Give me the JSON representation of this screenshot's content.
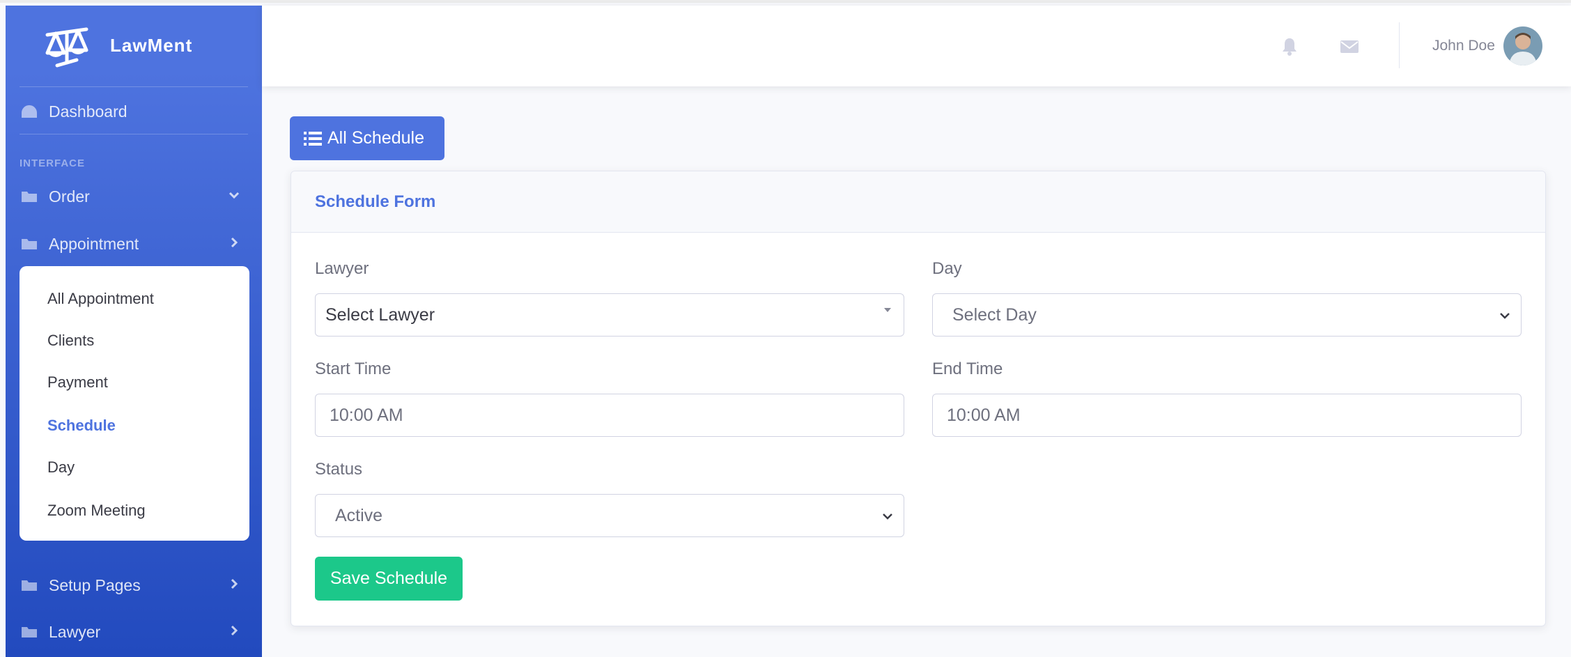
{
  "brand": {
    "name": "LawMent"
  },
  "sidebar": {
    "dashboard_label": "Dashboard",
    "heading": "INTERFACE",
    "items": [
      {
        "label": "Order",
        "chevron": "down"
      },
      {
        "label": "Appointment",
        "chevron": "right"
      },
      {
        "label": "Setup Pages",
        "chevron": "right"
      },
      {
        "label": "Lawyer",
        "chevron": "right"
      }
    ],
    "submenu": [
      {
        "label": "All Appointment"
      },
      {
        "label": "Clients"
      },
      {
        "label": "Payment"
      },
      {
        "label": "Schedule",
        "active": true
      },
      {
        "label": "Day"
      },
      {
        "label": "Zoom Meeting"
      }
    ]
  },
  "topbar": {
    "icons": [
      "bell-icon",
      "envelope-icon"
    ],
    "user_name": "John Doe"
  },
  "main": {
    "all_schedule_button": "All Schedule",
    "card_title": "Schedule Form",
    "form": {
      "lawyer_label": "Lawyer",
      "lawyer_value": "Select Lawyer",
      "day_label": "Day",
      "day_value": "Select Day",
      "start_time_label": "Start Time",
      "start_time_value": "10:00 AM",
      "end_time_label": "End Time",
      "end_time_value": "10:00 AM",
      "status_label": "Status",
      "status_value": "Active",
      "save_button": "Save Schedule"
    }
  },
  "colors": {
    "primary": "#4e73df",
    "success": "#1cc88a",
    "sidebar_gradient_end": "#224abe",
    "text_muted": "#858796"
  }
}
